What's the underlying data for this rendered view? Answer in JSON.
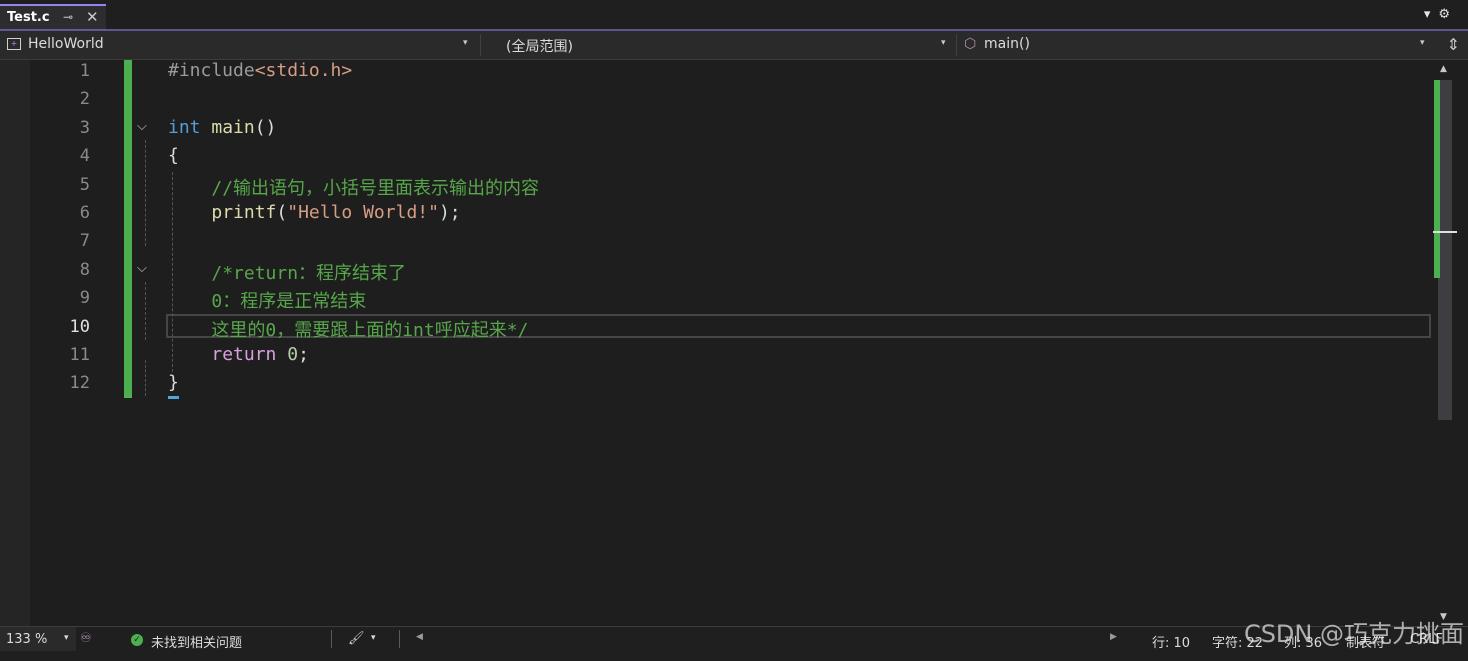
{
  "tab": {
    "title": "Test.c",
    "pin_glyph": "⊸",
    "close_glyph": "✕"
  },
  "tabbar_right": {
    "dropdown_glyph": "▾",
    "settings_glyph": "⚙"
  },
  "navbar": {
    "project": "HelloWorld",
    "scope": "(全局范围)",
    "member": "main()",
    "arrow_glyph": "▾",
    "split_glyph": "⇕"
  },
  "editor": {
    "current_line": 10,
    "lines": [
      {
        "n": "1",
        "tokens": [
          [
            "tk-pp",
            "#include"
          ],
          [
            "tk-inc",
            "<stdio.h>"
          ]
        ]
      },
      {
        "n": "2",
        "tokens": []
      },
      {
        "n": "3",
        "tokens": [
          [
            "tk-kw",
            "int"
          ],
          [
            "tk-pl",
            " "
          ],
          [
            "tk-fn",
            "main"
          ],
          [
            "tk-pl",
            "()"
          ]
        ]
      },
      {
        "n": "4",
        "tokens": [
          [
            "tk-pl",
            "{"
          ]
        ]
      },
      {
        "n": "5",
        "tokens": [
          [
            "tk-pl",
            "    "
          ],
          [
            "tk-cm",
            "//输出语句，小括号里面表示输出的内容"
          ]
        ]
      },
      {
        "n": "6",
        "tokens": [
          [
            "tk-pl",
            "    "
          ],
          [
            "tk-fn",
            "printf"
          ],
          [
            "tk-pl",
            "("
          ],
          [
            "tk-str",
            "\"Hello World!\""
          ],
          [
            "tk-pl",
            ");"
          ]
        ]
      },
      {
        "n": "7",
        "tokens": []
      },
      {
        "n": "8",
        "tokens": [
          [
            "tk-pl",
            "    "
          ],
          [
            "tk-cm",
            "/*return：程序结束了"
          ]
        ]
      },
      {
        "n": "9",
        "tokens": [
          [
            "tk-pl",
            "    "
          ],
          [
            "tk-cm",
            "0：程序是正常结束"
          ]
        ]
      },
      {
        "n": "10",
        "tokens": [
          [
            "tk-pl",
            "    "
          ],
          [
            "tk-cm",
            "这里的0，需要跟上面的int呼应起来*/"
          ]
        ]
      },
      {
        "n": "11",
        "tokens": [
          [
            "tk-pl",
            "    "
          ],
          [
            "tk-ret",
            "return"
          ],
          [
            "tk-pl",
            " "
          ],
          [
            "tk-num",
            "0"
          ],
          [
            "tk-pl",
            ";"
          ]
        ]
      },
      {
        "n": "12",
        "tokens": [
          [
            "tk-pl",
            "}"
          ]
        ]
      }
    ],
    "fold_glyph": "⌵"
  },
  "status": {
    "zoom": "133 %",
    "zoom_arrow": "▾",
    "issues": "未找到相关问题",
    "check_glyph": "✓",
    "brush_glyph": "🖌",
    "brush_arrow": "▾",
    "scroll_left": "◀",
    "scroll_right": "▶",
    "row": "行: 10",
    "char": "字符: 22",
    "col": "列: 36",
    "tabs": "制表符",
    "eol": "CRLF"
  },
  "scrollbar": {
    "up": "▲",
    "down": "▼"
  },
  "watermark": "CSDN @巧克力挑面",
  "colors": {
    "accent": "#9184ee",
    "changebar": "#4caf50"
  }
}
